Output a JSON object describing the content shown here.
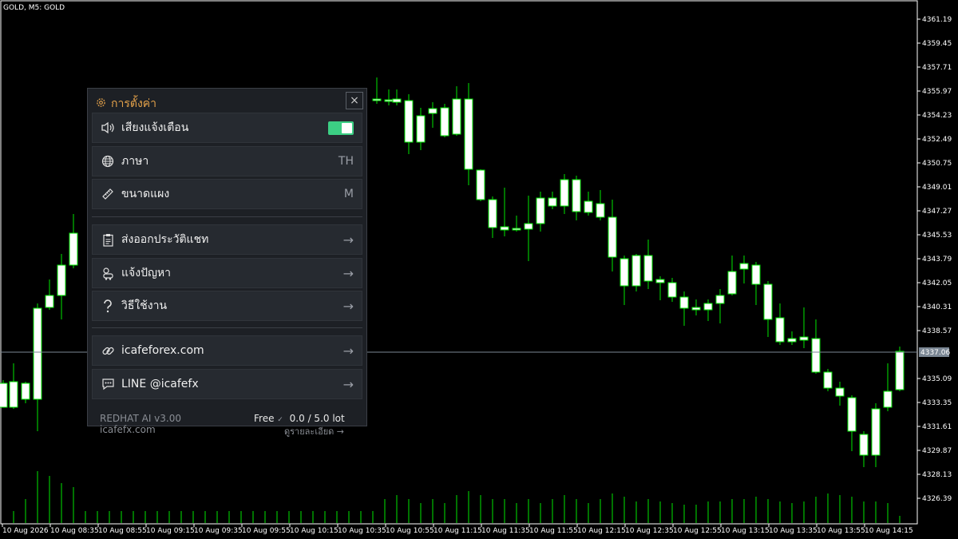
{
  "chart": {
    "symbol_label": "GOLD, M5:  GOLD",
    "current_price": "4337.06",
    "price_ticks": [
      "4361.19",
      "4359.45",
      "4357.71",
      "4355.97",
      "4354.23",
      "4352.49",
      "4350.75",
      "4349.01",
      "4347.27",
      "4345.53",
      "4343.79",
      "4342.05",
      "4340.31",
      "4338.57",
      "4335.09",
      "4333.35",
      "4331.61",
      "4329.87",
      "4328.13",
      "4326.39"
    ],
    "time_ticks": [
      "10 Aug 2026",
      "10 Aug 08:35",
      "10 Aug 08:55",
      "10 Aug 09:15",
      "10 Aug 09:35",
      "10 Aug 09:55",
      "10 Aug 10:15",
      "10 Aug 10:35",
      "10 Aug 10:55",
      "10 Aug 11:15",
      "10 Aug 11:35",
      "10 Aug 11:55",
      "10 Aug 12:15",
      "10 Aug 12:35",
      "10 Aug 12:55",
      "10 Aug 13:15",
      "10 Aug 13:35",
      "10 Aug 13:55",
      "10 Aug 14:15"
    ],
    "colors": {
      "background": "#000000",
      "candle_body": "#ffffff",
      "wick": "#00e600",
      "volume": "#00e600",
      "price_line": "#7b8794"
    }
  },
  "settings": {
    "title": "การตั้งค่า",
    "close_label": "×",
    "sound": {
      "label": "เสียงแจ้งเตือน",
      "enabled": true
    },
    "language": {
      "label": "ภาษา",
      "value": "TH"
    },
    "panel_size": {
      "label": "ขนาดแผง",
      "value": "M"
    },
    "actions": [
      {
        "label": "ส่งออกประวัติแชท",
        "icon": "clipboard-icon",
        "arrow": "→"
      },
      {
        "label": "แจ้งปัญหา",
        "icon": "bug-icon",
        "arrow": "→"
      },
      {
        "label": "วิธีใช้งาน",
        "icon": "question-icon",
        "arrow": "→"
      }
    ],
    "links": [
      {
        "label": "icafeforex.com",
        "icon": "link-icon",
        "arrow": "→"
      },
      {
        "label": "LINE @icafefx",
        "icon": "chat-icon",
        "arrow": "→"
      }
    ],
    "footer": {
      "version": "REDHAT AI v3.00",
      "site": "icafefx.com",
      "plan": "Free",
      "plan_check": "✓",
      "lots": "0.0 / 5.0 lot",
      "details": "ดูรายละเอียด →"
    },
    "accent_color": "#e3a14a",
    "toggle_color": "#3ccf84"
  }
}
